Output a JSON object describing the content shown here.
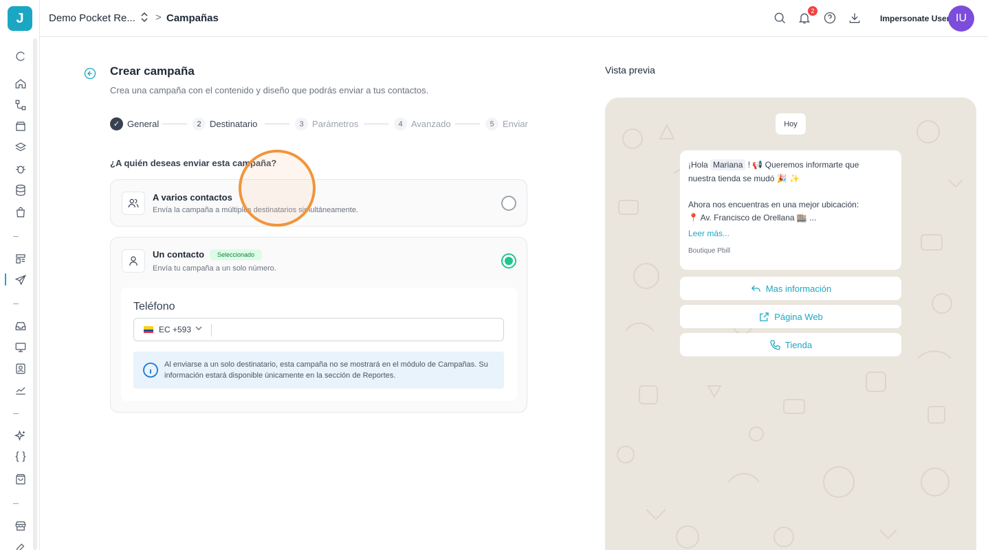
{
  "app": {
    "logo_letter": "J",
    "accent": "#1ba7c4"
  },
  "sidebar": {
    "icons": [
      "refresh-icon",
      "home-icon",
      "flow-icon",
      "archive-icon",
      "layers-icon",
      "bug-icon",
      "database-icon",
      "bag-icon",
      "layout-icon",
      "send-icon",
      "inbox-icon",
      "monitor-icon",
      "contact-icon",
      "chart-icon",
      "sparkles-icon",
      "braces-icon",
      "store-bag-icon",
      "store-icon"
    ],
    "braces_text": "{ }"
  },
  "topbar": {
    "workspace": "Demo Pocket Re...",
    "separator": ">",
    "page": "Campañas",
    "notifications_count": "2",
    "user_name": "Impersonate User",
    "avatar_initials": "IU"
  },
  "main": {
    "title": "Crear campaña",
    "subtitle": "Crea una campaña con el contenido y diseño que podrás enviar a tus contactos.",
    "steps": [
      {
        "num": "✓",
        "label": "General"
      },
      {
        "num": "2",
        "label": "Destinatario"
      },
      {
        "num": "3",
        "label": "Parámetros"
      },
      {
        "num": "4",
        "label": "Avanzado"
      },
      {
        "num": "5",
        "label": "Enviar"
      }
    ],
    "question": "¿A quién deseas enviar esta campaña?",
    "option_multi": {
      "title": "A varios contactos",
      "desc": "Envía la campaña a múltiples destinatarios simultáneamente."
    },
    "option_single": {
      "title": "Un contacto",
      "badge": "Seleccionado",
      "desc": "Envía tu campaña a un solo número."
    },
    "phone": {
      "label": "Teléfono",
      "country_code": "EC +593",
      "value": ""
    },
    "info": "Al enviarse a un solo destinatario, esta campaña no se mostrará en el módulo de Campañas. Su información estará disponible únicamente en la sección de Reportes."
  },
  "preview": {
    "title": "Vista previa",
    "date_chip": "Hoy",
    "message": {
      "line1_pre": "¡Hola ",
      "name": "Mariana",
      "line1_post": " ! 📢 Queremos informarte que",
      "line2": "nuestra tienda se mudó 🎉 ✨",
      "line3": "Ahora nos encuentras en una mejor ubicación:",
      "line4": "📍 Av. Francisco de Orellana 🏬 ...",
      "read_more": "Leer más...",
      "footer": "Boutique Pbill"
    },
    "buttons": [
      {
        "label": "Mas información",
        "icon": "reply-icon"
      },
      {
        "label": "Página Web",
        "icon": "external-link-icon"
      },
      {
        "label": "Tienda",
        "icon": "phone-icon"
      }
    ]
  }
}
